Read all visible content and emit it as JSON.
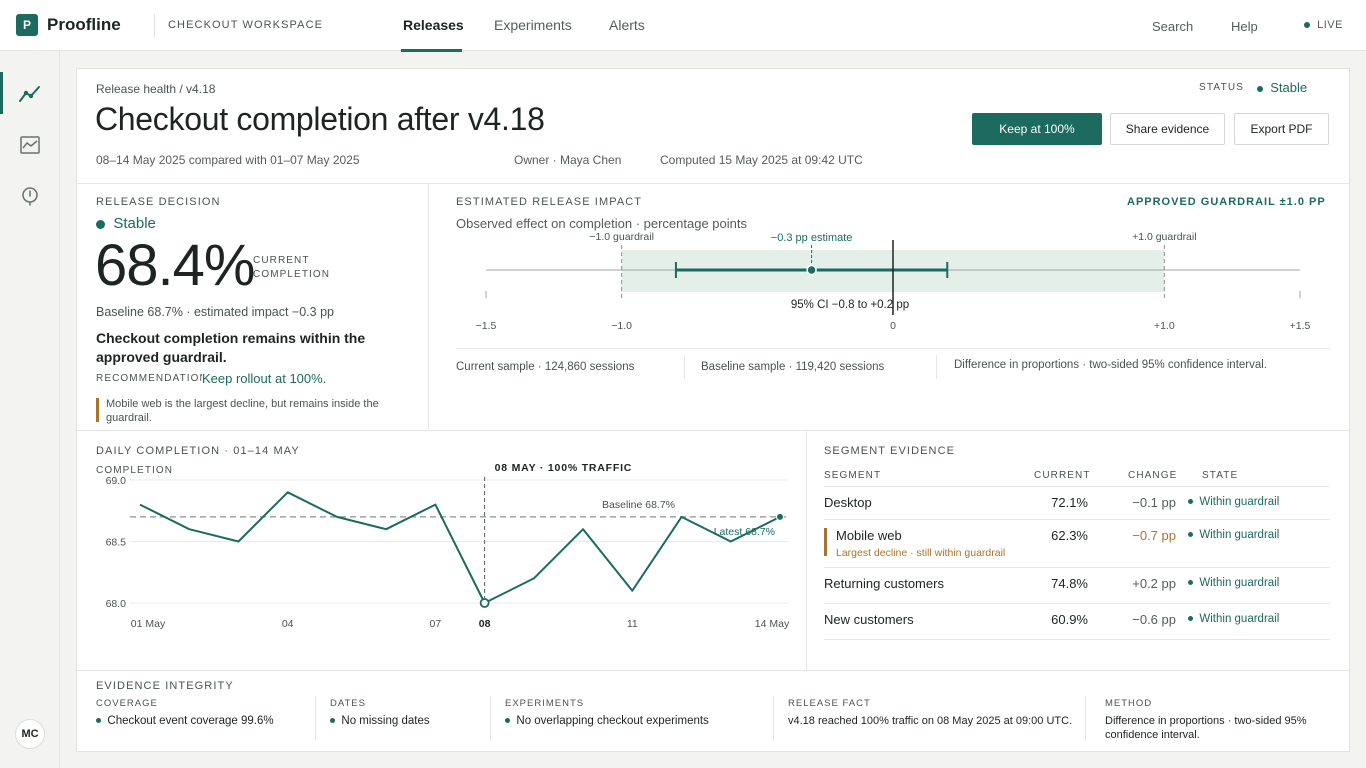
{
  "app": {
    "logo_letter": "P",
    "name": "Proofline",
    "workspace": "CHECKOUT WORKSPACE"
  },
  "nav": {
    "tabs": [
      "Releases",
      "Experiments",
      "Alerts"
    ],
    "search": "Search",
    "help": "Help",
    "live": "LIVE"
  },
  "user": {
    "initials": "MC"
  },
  "header": {
    "breadcrumb": "Release health / v4.18",
    "title": "Checkout completion after v4.18",
    "period": "08–14 May 2025 compared with 01–07 May 2025",
    "owner": "Owner · Maya Chen",
    "computed": "Computed 15 May 2025 at 09:42 UTC",
    "status_label": "STATUS",
    "status_value": "Stable",
    "buttons": {
      "keep": "Keep at 100%",
      "share": "Share evidence",
      "export": "Export PDF"
    }
  },
  "decision": {
    "title": "RELEASE DECISION",
    "status": "Stable",
    "value": "68.4%",
    "value_label": "CURRENT COMPLETION",
    "baseline": "Baseline 68.7% · estimated impact −0.3 pp",
    "headline": "Checkout completion remains within the approved guardrail.",
    "rec_label": "RECOMMENDATION",
    "rec_value": "Keep rollout at 100%.",
    "note": "Mobile web is the largest decline, but remains inside the guardrail."
  },
  "impact": {
    "title": "ESTIMATED RELEASE IMPACT",
    "guardrail": "APPROVED GUARDRAIL ±1.0 PP",
    "subtitle": "Observed effect on completion · percentage points",
    "estimate": -0.3,
    "ci": [
      -0.8,
      0.2
    ],
    "guardrail_range": [
      -1.0,
      1.0
    ],
    "axis_range": [
      -1.5,
      1.5
    ],
    "ticks": [
      "−1.5",
      "−1.0",
      "0",
      "+1.0",
      "+1.5"
    ],
    "label_low": "−1.0 guardrail",
    "label_est": "−0.3 pp estimate",
    "label_high": "+1.0 guardrail",
    "label_ci": "95% CI −0.8 to +0.2 pp",
    "foot_current": "Current sample · 124,860 sessions",
    "foot_baseline": "Baseline sample · 119,420 sessions",
    "foot_method": "Difference in proportions · two-sided 95% confidence interval."
  },
  "daily": {
    "title": "DAILY COMPLETION · 01–14 MAY",
    "ylabel": "COMPLETION",
    "marker_label": "08 MAY · 100% TRAFFIC",
    "baseline_label": "Baseline 68.7%",
    "latest_label": "Latest 68.7%"
  },
  "chart_data": {
    "type": "line",
    "x": [
      1,
      2,
      3,
      4,
      5,
      6,
      7,
      8,
      9,
      10,
      11,
      12,
      13,
      14
    ],
    "values": [
      68.8,
      68.6,
      68.5,
      68.9,
      68.7,
      68.6,
      68.8,
      68.0,
      68.2,
      68.6,
      68.1,
      68.7,
      68.5,
      68.7
    ],
    "ylim": [
      68.0,
      69.0
    ],
    "yticks": [
      "69.0",
      "68.5",
      "68.0"
    ],
    "xticks": [
      {
        "x": 1,
        "label": "01 May"
      },
      {
        "x": 4,
        "label": "04"
      },
      {
        "x": 7,
        "label": "07"
      },
      {
        "x": 8,
        "label": "08"
      },
      {
        "x": 11,
        "label": "11"
      },
      {
        "x": 14,
        "label": "14 May"
      }
    ],
    "baseline": 68.7,
    "marker_x": 8,
    "color": "#1c6b5e"
  },
  "segments": {
    "title": "SEGMENT EVIDENCE",
    "headers": [
      "SEGMENT",
      "CURRENT",
      "CHANGE",
      "STATE"
    ],
    "rows": [
      {
        "name": "Desktop",
        "current": "72.1%",
        "change": "−0.1 pp",
        "state": "Within guardrail",
        "note": ""
      },
      {
        "name": "Mobile web",
        "current": "62.3%",
        "change": "−0.7 pp",
        "state": "Within guardrail",
        "note": "Largest decline · still within guardrail"
      },
      {
        "name": "Returning customers",
        "current": "74.8%",
        "change": "+0.2 pp",
        "state": "Within guardrail",
        "note": ""
      },
      {
        "name": "New customers",
        "current": "60.9%",
        "change": "−0.6 pp",
        "state": "Within guardrail",
        "note": ""
      }
    ]
  },
  "evidence": {
    "title": "EVIDENCE INTEGRITY",
    "items": [
      {
        "label": "COVERAGE",
        "value": "Checkout event coverage 99.6%"
      },
      {
        "label": "DATES",
        "value": "No missing dates"
      },
      {
        "label": "EXPERIMENTS",
        "value": "No overlapping checkout experiments"
      },
      {
        "label": "RELEASE FACT",
        "value": "v4.18 reached 100% traffic on 08 May 2025 at 09:00 UTC."
      },
      {
        "label": "METHOD",
        "value": "Difference in proportions · two-sided 95% confidence interval."
      }
    ]
  },
  "colors": {
    "accent": "#1c6b5e",
    "warning": "#a8742a",
    "band": "#e4efea"
  }
}
